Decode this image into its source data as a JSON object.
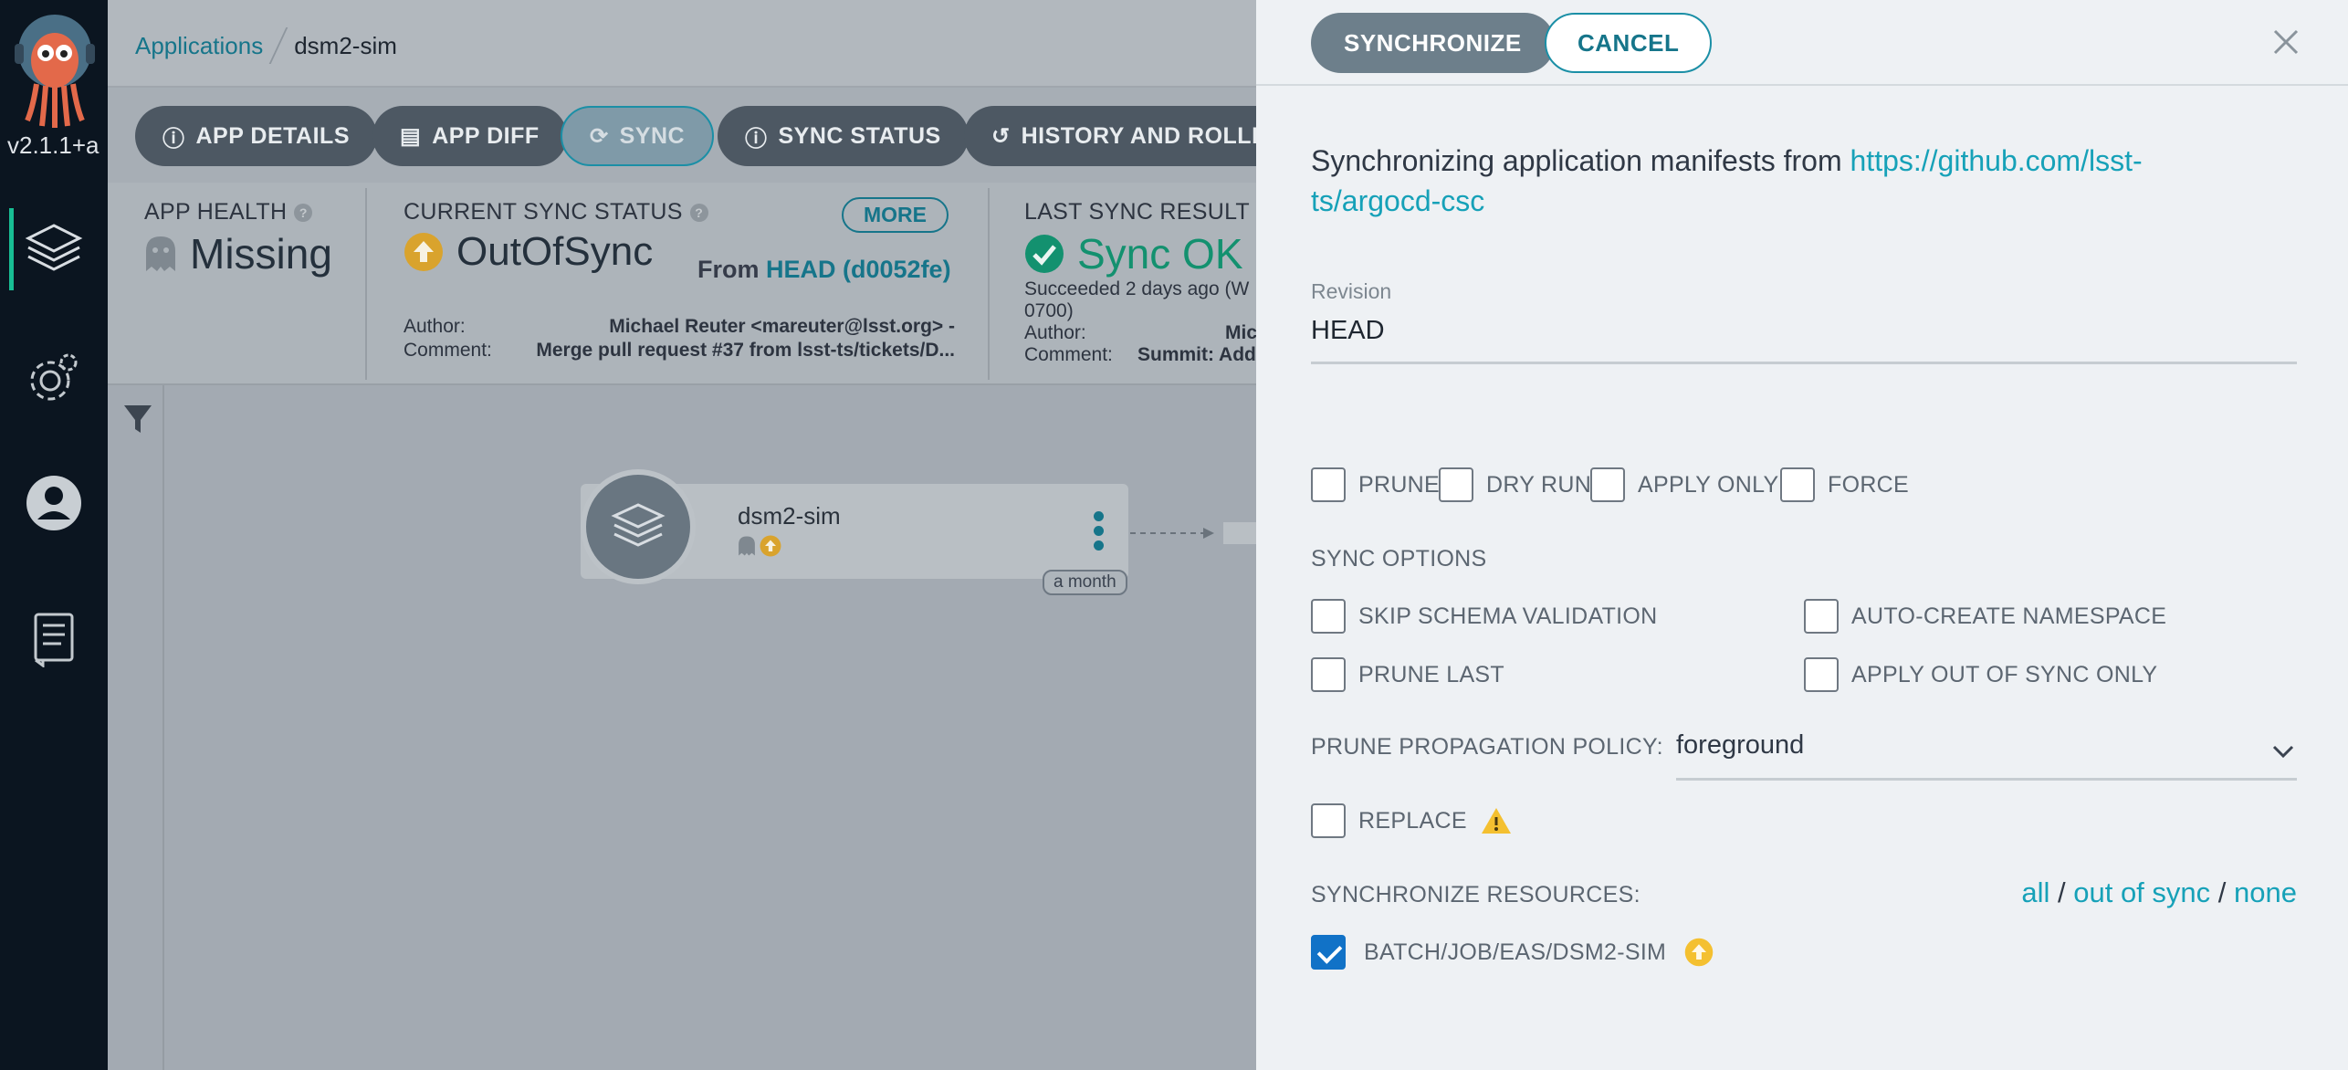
{
  "nav": {
    "version": "v2.1.1+a",
    "items": [
      {
        "name": "applications",
        "icon": "layers-icon",
        "active": true
      },
      {
        "name": "settings",
        "icon": "gear-icon",
        "active": false
      },
      {
        "name": "user-info",
        "icon": "user-icon",
        "active": false
      },
      {
        "name": "documentation",
        "icon": "docs-icon",
        "active": false
      }
    ]
  },
  "breadcrumb": {
    "link": "Applications",
    "current": "dsm2-sim"
  },
  "toolbar": {
    "app_details": "APP DETAILS",
    "app_diff": "APP DIFF",
    "sync": "SYNC",
    "sync_status": "SYNC STATUS",
    "history": "HISTORY AND ROLLBA"
  },
  "status": {
    "app_health": {
      "title": "APP HEALTH",
      "value": "Missing"
    },
    "current_sync": {
      "title": "CURRENT SYNC STATUS",
      "more": "MORE",
      "value": "OutOfSync",
      "from_label": "From",
      "from_value": "HEAD (d0052fe)",
      "author_label": "Author:",
      "author_value": "Michael Reuter <mareuter@lsst.org> -",
      "comment_label": "Comment:",
      "comment_value": "Merge pull request #37 from lsst-ts/tickets/D..."
    },
    "last_sync": {
      "title": "LAST SYNC RESULT",
      "value": "Sync OK",
      "succeeded_line1": "Succeeded 2 days ago (W",
      "succeeded_line2": "0700)",
      "author_label": "Author:",
      "author_value": "Mic",
      "comment_label": "Comment:",
      "comment_value": "Summit: Add"
    }
  },
  "graph": {
    "node_name": "dsm2-sim",
    "node_age": "a month"
  },
  "panel": {
    "synchronize_btn": "SYNCHRONIZE",
    "cancel_btn": "CANCEL",
    "message_prefix": "Synchronizing application manifests from ",
    "repo_url_line1": "https://github.com/lsst-",
    "repo_url_line2": "ts/argocd-csc",
    "revision_label": "Revision",
    "revision_value": "HEAD",
    "options": {
      "prune": "PRUNE",
      "dry_run": "DRY RUN",
      "apply_only": "APPLY ONLY",
      "force": "FORCE"
    },
    "sync_options_label": "SYNC OPTIONS",
    "sync_options": {
      "skip_schema": "SKIP SCHEMA VALIDATION",
      "auto_create_ns": "AUTO-CREATE NAMESPACE",
      "prune_last": "PRUNE LAST",
      "apply_out_of_sync": "APPLY OUT OF SYNC ONLY"
    },
    "prune_policy_label": "PRUNE PROPAGATION POLICY:",
    "prune_policy_value": "foreground",
    "replace": "REPLACE",
    "sync_resources_label": "SYNCHRONIZE RESOURCES:",
    "res_all": "all",
    "res_sep": "/",
    "res_out_of_sync": "out of sync",
    "res_none": "none",
    "resource_item": "BATCH/JOB/EAS/DSM2-SIM"
  },
  "colors": {
    "accent": "#16a1b8",
    "healthy": "#18be94",
    "out_of_sync": "#f4c030",
    "checkbox_checked": "#1172c7"
  }
}
